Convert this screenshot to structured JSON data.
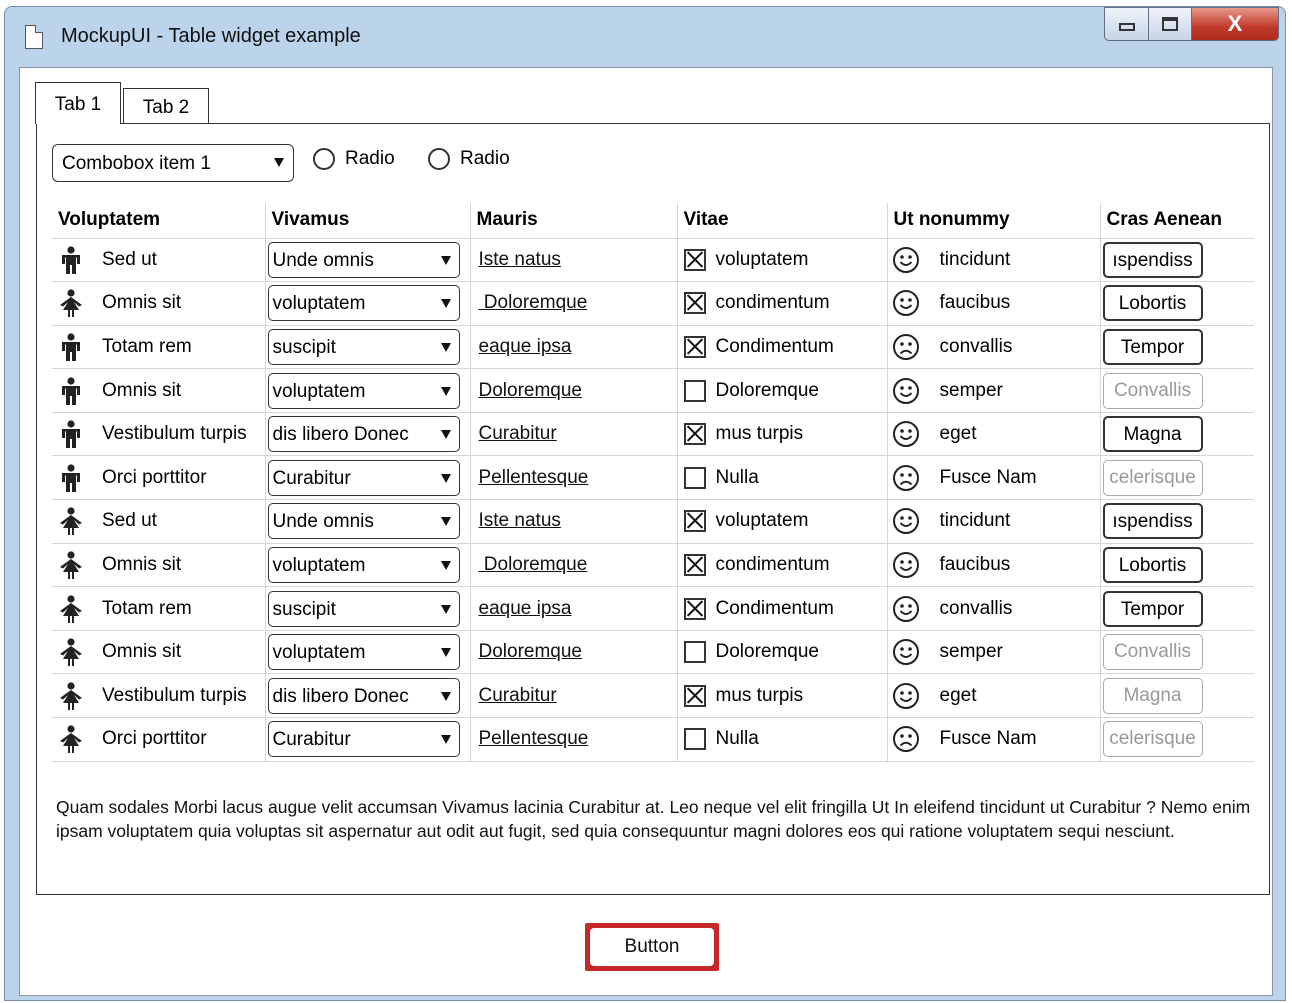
{
  "window": {
    "title": "MockupUI - Table widget example",
    "close_glyph": "X"
  },
  "tabs": [
    {
      "label": "Tab 1"
    },
    {
      "label": "Tab 2"
    }
  ],
  "combo": {
    "value": "Combobox item 1"
  },
  "radios": [
    {
      "label": "Radio"
    },
    {
      "label": "Radio"
    }
  ],
  "table": {
    "columns": [
      "Voluptatem",
      "Vivamus",
      "Mauris",
      "Vitae",
      "Ut nonummy",
      "Cras Aenean"
    ],
    "rows": [
      {
        "icon": "male-person-icon",
        "name": "Sed ut",
        "combo": "Unde omnis",
        "link": "Iste natus",
        "checked": true,
        "vitae": "voluptatem",
        "mood": "happy-face-icon",
        "ut": "tincidunt",
        "button": "ıspendiss",
        "enabled": true
      },
      {
        "icon": "female-person-icon",
        "name": "Omnis sit",
        "combo": "voluptatem",
        "link": " Doloremque",
        "checked": true,
        "vitae": "condimentum",
        "mood": "happy-face-icon",
        "ut": "faucibus",
        "button": "Lobortis",
        "enabled": true
      },
      {
        "icon": "male-person-icon",
        "name": "Totam rem",
        "combo": "suscipit",
        "link": "eaque ipsa",
        "checked": true,
        "vitae": "Condimentum",
        "mood": "sad-face-icon",
        "ut": "convallis",
        "button": "Tempor",
        "enabled": true
      },
      {
        "icon": "male-person-icon",
        "name": "Omnis sit",
        "combo": "voluptatem",
        "link": "Doloremque",
        "checked": false,
        "vitae": "Doloremque",
        "mood": "happy-face-icon",
        "ut": "semper",
        "button": "Convallis",
        "enabled": false
      },
      {
        "icon": "male-person-icon",
        "name": "Vestibulum turpis",
        "combo": "dis libero Donec",
        "link": "Curabitur",
        "checked": true,
        "vitae": "mus turpis",
        "mood": "happy-face-icon",
        "ut": "eget",
        "button": "Magna",
        "enabled": true
      },
      {
        "icon": "male-person-icon",
        "name": "Orci porttitor",
        "combo": "Curabitur",
        "link": "Pellentesque",
        "checked": false,
        "vitae": "Nulla",
        "mood": "sad-face-icon",
        "ut": "Fusce Nam",
        "button": "celerisque",
        "enabled": false
      },
      {
        "icon": "female-person-icon",
        "name": "Sed ut",
        "combo": "Unde omnis",
        "link": "Iste natus",
        "checked": true,
        "vitae": "voluptatem",
        "mood": "happy-face-icon",
        "ut": "tincidunt",
        "button": "ıspendiss",
        "enabled": true
      },
      {
        "icon": "female-person-icon",
        "name": "Omnis sit",
        "combo": "voluptatem",
        "link": " Doloremque",
        "checked": true,
        "vitae": "condimentum",
        "mood": "happy-face-icon",
        "ut": "faucibus",
        "button": "Lobortis",
        "enabled": true
      },
      {
        "icon": "female-person-icon",
        "name": "Totam rem",
        "combo": "suscipit",
        "link": "eaque ipsa",
        "checked": true,
        "vitae": "Condimentum",
        "mood": "happy-face-icon",
        "ut": "convallis",
        "button": "Tempor",
        "enabled": true
      },
      {
        "icon": "female-person-icon",
        "name": "Omnis sit",
        "combo": "voluptatem",
        "link": "Doloremque",
        "checked": false,
        "vitae": "Doloremque",
        "mood": "happy-face-icon",
        "ut": "semper",
        "button": "Convallis",
        "enabled": false
      },
      {
        "icon": "female-person-icon",
        "name": "Vestibulum turpis",
        "combo": "dis libero Donec",
        "link": "Curabitur",
        "checked": true,
        "vitae": "mus turpis",
        "mood": "happy-face-icon",
        "ut": "eget",
        "button": "Magna",
        "enabled": false
      },
      {
        "icon": "female-person-icon",
        "name": "Orci porttitor",
        "combo": "Curabitur",
        "link": "Pellentesque",
        "checked": false,
        "vitae": "Nulla",
        "mood": "sad-face-icon",
        "ut": "Fusce Nam",
        "button": "celerisque",
        "enabled": false
      }
    ]
  },
  "paragraph": "Quam sodales Morbi lacus augue velit accumsan Vivamus lacinia Curabitur at. Leo neque vel elit fringilla Ut In eleifend tincidunt ut Curabitur ? Nemo enim ipsam voluptatem quia voluptas sit aspernatur aut odit aut fugit, sed quia consequuntur magni dolores eos qui ratione voluptatem sequi nesciunt.",
  "main_button": {
    "label": "Button"
  },
  "colors": {
    "titlebar": "#bcd3ec",
    "close_button": "#c0392b",
    "focus_border": "#c62828"
  }
}
